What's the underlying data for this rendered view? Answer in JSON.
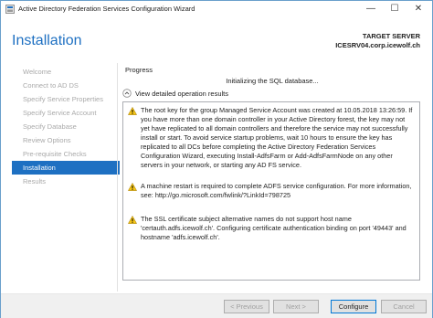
{
  "window": {
    "title": "Active Directory Federation Services Configuration Wizard",
    "controls": {
      "minimize": "—",
      "maximize": "☐",
      "close": "✕"
    }
  },
  "header": {
    "page_title": "Installation",
    "target_label": "TARGET SERVER",
    "target_server": "ICESRV04.corp.icewolf.ch"
  },
  "sidebar": {
    "items": [
      {
        "label": "Welcome",
        "active": false
      },
      {
        "label": "Connect to AD DS",
        "active": false
      },
      {
        "label": "Specify Service Properties",
        "active": false
      },
      {
        "label": "Specify Service Account",
        "active": false
      },
      {
        "label": "Specify Database",
        "active": false
      },
      {
        "label": "Review Options",
        "active": false
      },
      {
        "label": "Pre-requisite Checks",
        "active": false
      },
      {
        "label": "Installation",
        "active": true
      },
      {
        "label": "Results",
        "active": false
      }
    ]
  },
  "content": {
    "section_title": "Progress",
    "status_text": "Initializing the SQL database...",
    "collapse_label": "View detailed operation results",
    "warnings": [
      "The root key for the group Managed Service Account was created at 10.05.2018 13:26:59. If you have more than one domain controller in your Active Directory forest, the key may not yet have replicated to all domain controllers and therefore the service may not successfully install or start. To avoid service startup problems, wait 10 hours to ensure the key has replicated to all DCs before completing the Active Directory Federation Services Configuration Wizard, executing Install-AdfsFarm or Add-AdfsFarmNode on any other servers in your network, or starting any AD FS service.",
      "A machine restart is required to complete ADFS service configuration. For more information, see: http://go.microsoft.com/fwlink/?LinkId=798725",
      "The SSL certificate subject alternative names do not support host name 'certauth.adfs.icewolf.ch'. Configuring certificate authentication binding on port '49443' and hostname 'adfs.icewolf.ch'."
    ]
  },
  "footer": {
    "previous_label": "< Previous",
    "next_label": "Next >",
    "configure_label": "Configure",
    "cancel_label": "Cancel"
  },
  "colors": {
    "accent": "#1e70c2",
    "warning_yellow": "#f5c518",
    "disabled_text": "#a9a9a9"
  }
}
